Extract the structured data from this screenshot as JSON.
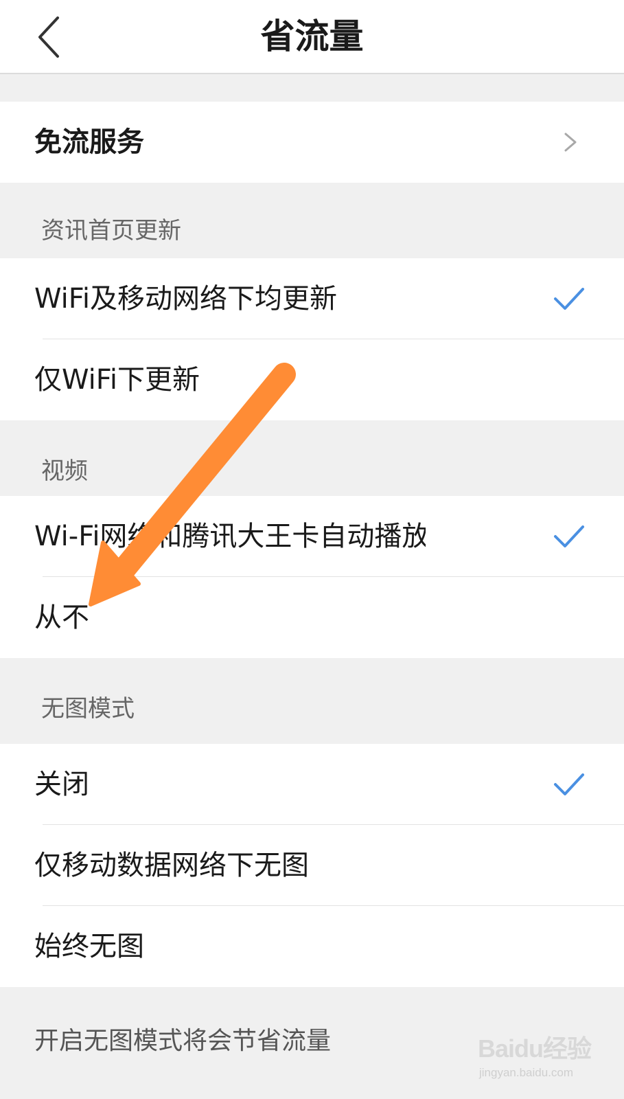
{
  "header": {
    "title": "省流量"
  },
  "rows": {
    "free_traffic": "免流服务",
    "news_both": "WiFi及移动网络下均更新",
    "news_wifi_only": "仅WiFi下更新",
    "video_autoplay": "Wi-Fi网络和腾讯大王卡自动播放",
    "video_never": "从不",
    "noimg_off": "关闭",
    "noimg_mobile": "仅移动数据网络下无图",
    "noimg_always": "始终无图"
  },
  "sections": {
    "news": "资讯首页更新",
    "video": "视频",
    "no_image": "无图模式"
  },
  "footer": {
    "note": "开启无图模式将会节省流量"
  },
  "watermark": {
    "brand": "Baidu经验",
    "url": "jingyan.baidu.com"
  },
  "colors": {
    "check": "#4a90e2",
    "arrow": "#ff8c35",
    "section_bg": "#f0f0f0"
  },
  "icons": {
    "back": "chevron-left-icon",
    "forward": "chevron-right-icon",
    "selected": "checkmark-icon"
  }
}
